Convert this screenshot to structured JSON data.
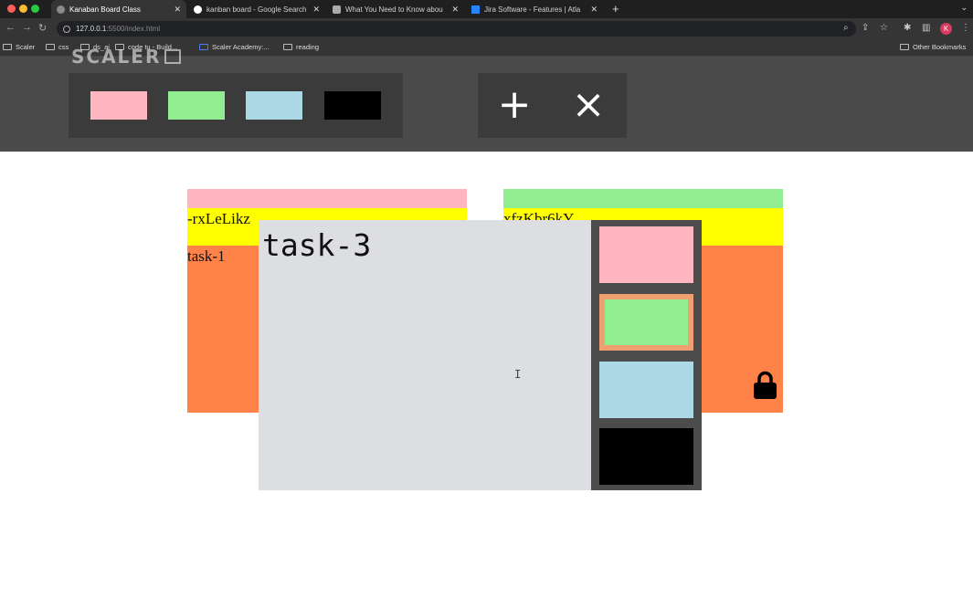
{
  "browser": {
    "tabs": [
      {
        "title": "Kanaban Board Class",
        "active": true
      },
      {
        "title": "kanban board - Google Search",
        "active": false
      },
      {
        "title": "What You Need to Know abou",
        "active": false
      },
      {
        "title": "Jira Software - Features | Atla",
        "active": false
      }
    ],
    "url_host": "127.0.0.1",
    "url_rest": ":5500/index.html",
    "profile_initial": "K",
    "bookmarks": [
      "Scaler",
      "css",
      "ds_ai",
      "code tu - Build...",
      "Scaler Academy:...",
      "reading"
    ],
    "other_bookmarks": "Other Bookmarks"
  },
  "watermark": "SCALER",
  "toolbar": {
    "filters": [
      {
        "name": "pink",
        "color": "#ffb6c1"
      },
      {
        "name": "green",
        "color": "#90ee90"
      },
      {
        "name": "blue",
        "color": "#add8e6"
      },
      {
        "name": "black",
        "color": "#000000"
      }
    ],
    "add_label": "+",
    "remove_label": "×"
  },
  "tickets": [
    {
      "id": "-rxLeLikz",
      "task": "task-1",
      "color": "#ffb6c1",
      "locked": false
    },
    {
      "id": "xfzKbr6kY",
      "task": "",
      "color": "#90ee90",
      "locked": true
    }
  ],
  "modal": {
    "text": "task-3",
    "priority_colors": [
      {
        "name": "pink",
        "color": "#ffb6c1",
        "selected": false
      },
      {
        "name": "green",
        "color": "#90ee90",
        "selected": true
      },
      {
        "name": "blue",
        "color": "#add8e6",
        "selected": false
      },
      {
        "name": "black",
        "color": "#000000",
        "selected": false
      }
    ]
  },
  "colors": {
    "ticket_body": "#ff8348",
    "ticket_id_band": "#ffff00",
    "toolbar_bg": "#4a4a4a",
    "modal_bg": "#dcdee1"
  }
}
